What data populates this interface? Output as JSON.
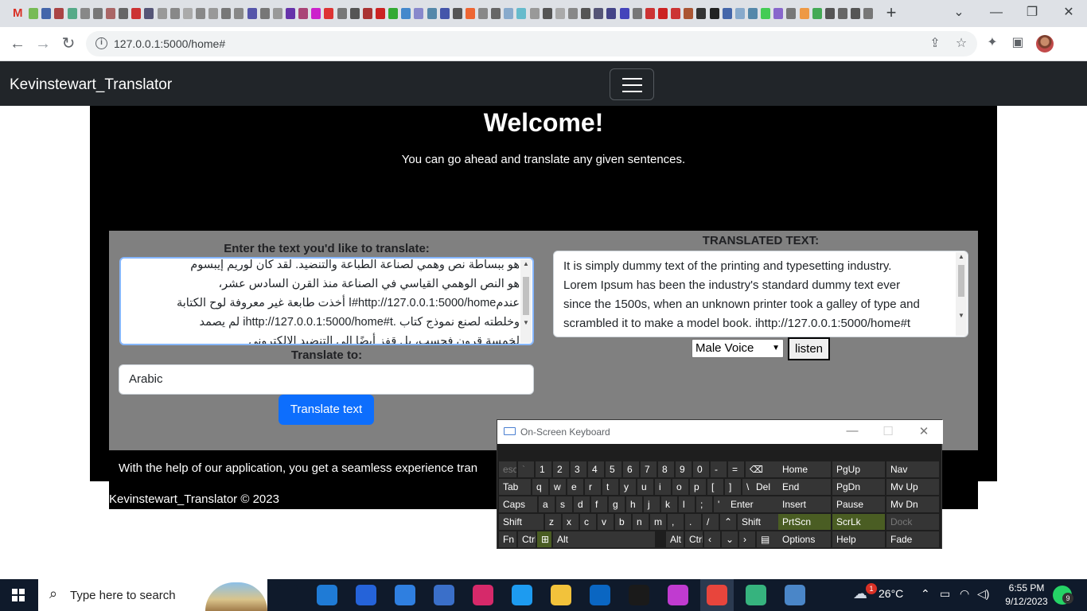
{
  "browser": {
    "url": "127.0.0.1:5000/home#"
  },
  "app": {
    "brand": "Kevinstewart_Translator"
  },
  "hero": {
    "title": "Welcome!",
    "subtitle": "You can go ahead and translate any given sentences."
  },
  "form": {
    "input_label": "Enter the text you'd like to translate:",
    "input_lines": [
      "هو ببساطة نص وهمي لصناعة الطباعة والتنضيد. لقد كان لوريم إيبسوم",
      "هو النص الوهمي القياسي في الصناعة منذ القرن السادس عشر،",
      "عندمhttp://127.0.0.1:5000/home#ا أخذت طابعة غير معروفة لوح الكتابة",
      "وخلطته لصنع نموذج كتاب .ihttp://127.0.0.1:5000/home#t لم يصمد",
      "لخمسة قرون فحسب، بل قفز أيضًا إلى التنضيد الإلكتروني"
    ],
    "target_label": "Translate to:",
    "target_value": "Arabic",
    "translate_button": "Translate text"
  },
  "output": {
    "label": "TRANSLATED TEXT:",
    "lines": [
      "It is simply dummy text of the printing and typesetting industry.",
      "Lorem Ipsum has been the industry's standard dummy text ever",
      "since the 1500s, when an unknown printer took a galley of type and",
      "scrambled it to make a model book. ihttp://127.0.0.1:5000/home#t"
    ],
    "voice_selected": "Male Voice",
    "listen_button": "listen"
  },
  "footer": {
    "text": "With the help of our application, you get a seamless experience tran",
    "copyright": "Kevinstewart_Translator © 2023"
  },
  "osk": {
    "title": "On-Screen Keyboard"
  },
  "taskbar": {
    "search_placeholder": "Type here to search",
    "weather": "26°C",
    "time": "6:55 PM",
    "date": "9/12/2023",
    "weather_badge": "1",
    "whatsapp_badge": "9"
  },
  "colors": {
    "navbar": "#212529",
    "primary_button": "#0d6efd",
    "panel": "#808080",
    "hero": "#000000",
    "osk_green": "#4a5d23"
  }
}
